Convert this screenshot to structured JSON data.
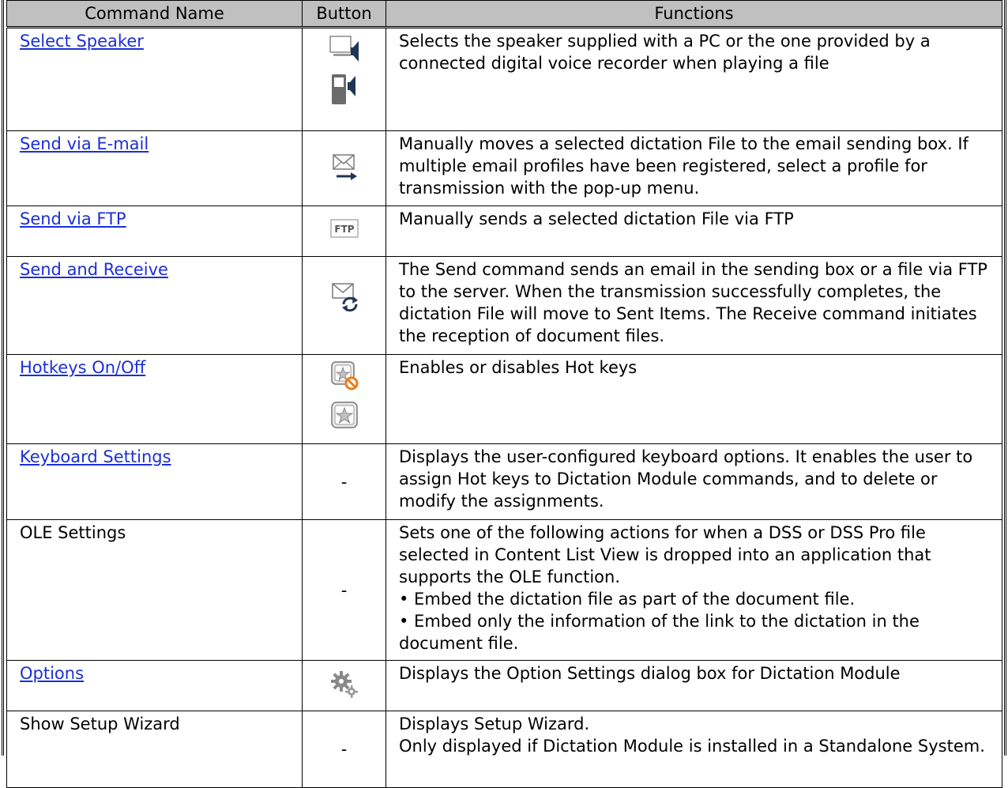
{
  "header": {
    "command_name": "Command Name",
    "button": "Button",
    "functions": "Functions"
  },
  "rows": [
    {
      "name": "Select Speaker",
      "link": true,
      "button": "",
      "icons": [
        "pc-speaker-icon",
        "recorder-speaker-icon"
      ],
      "functions": "Selects the speaker supplied with a PC or the one provided by a connected digital voice recorder when playing a file"
    },
    {
      "name": "Send via E-mail",
      "link": true,
      "button": "",
      "icons": [
        "email-send-icon"
      ],
      "functions": "Manually moves a selected dictation File to the email sending box. If multiple email profiles have been registered, select a profile for transmission with the pop-up menu."
    },
    {
      "name": "Send via FTP",
      "link": true,
      "button": "",
      "icons": [
        "ftp-icon"
      ],
      "functions": "Manually sends a selected dictation File via FTP"
    },
    {
      "name": "Send and Receive",
      "link": true,
      "button": "",
      "icons": [
        "send-receive-icon"
      ],
      "functions": "The Send command sends an email in the sending box or a file via FTP to the server. When the transmission successfully completes, the dictation File will move to Sent Items. The Receive command initiates the reception of document files."
    },
    {
      "name": "Hotkeys On/Off",
      "link": true,
      "button": "",
      "icons": [
        "hotkeys-off-icon",
        "hotkeys-on-icon"
      ],
      "functions": "Enables or disables Hot keys"
    },
    {
      "name": "Keyboard Settings",
      "link": true,
      "button": "-",
      "icons": [],
      "functions": "Displays the user-configured keyboard options. It enables the user to assign Hot keys to Dictation Module commands, and to delete or modify the assignments."
    },
    {
      "name": "OLE Settings",
      "link": false,
      "button": "-",
      "icons": [],
      "functions": "Sets one of the following actions for when a DSS or DSS Pro file selected in Content List View is dropped into an application that supports the OLE function.",
      "bullets": [
        "• Embed the dictation file as part of the document file.",
        "• Embed only the information of the link to the dictation in the document file."
      ]
    },
    {
      "name": "Options",
      "link": true,
      "button": "",
      "icons": [
        "options-gears-icon"
      ],
      "functions": "Displays the Option Settings dialog box for Dictation Module"
    },
    {
      "name": "Show Setup Wizard",
      "link": false,
      "button": "-",
      "icons": [],
      "functions": "Displays Setup Wizard.",
      "bullets": [
        "Only displayed if Dictation Module is installed in a Standalone System."
      ]
    }
  ],
  "icon_labels": {
    "ftp": "FTP"
  },
  "colors": {
    "link": "#1b2fd8",
    "header_bg": "#c0c0c0",
    "icon_navy": "#1f3556",
    "icon_gray": "#8a8a8a",
    "no_sign": "#f07a1a"
  }
}
